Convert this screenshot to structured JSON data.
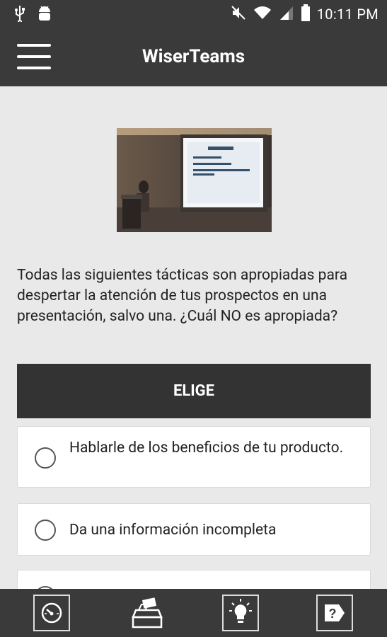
{
  "status": {
    "time": "10:11 PM",
    "icons": [
      "usb-icon",
      "android-debug-icon",
      "mute-icon",
      "wifi-icon",
      "signal-icon",
      "battery-icon"
    ]
  },
  "app": {
    "title": "WiserTeams"
  },
  "question": {
    "image_semantic": "presentation-photo",
    "text": "Todas las siguientes tácticas son apropiadas para despertar la atención de tus prospectos en una presentación,  salvo una.  ¿Cuál NO es apropiada?"
  },
  "choose": {
    "header": "ELIGE"
  },
  "options": [
    {
      "label": "Hablarle de los beneficios de tu producto.",
      "selected": false
    },
    {
      "label": "Da una información incompleta",
      "selected": false
    },
    {
      "label": "",
      "selected": false
    }
  ],
  "bottom_nav": [
    {
      "icon": "speedometer-icon"
    },
    {
      "icon": "voting-icon"
    },
    {
      "icon": "lightbulb-icon"
    },
    {
      "icon": "question-tag-icon"
    }
  ],
  "colors": {
    "bar": "#3a3a3a",
    "background": "#e9e9e9",
    "header": "#333333",
    "card": "#ffffff"
  }
}
